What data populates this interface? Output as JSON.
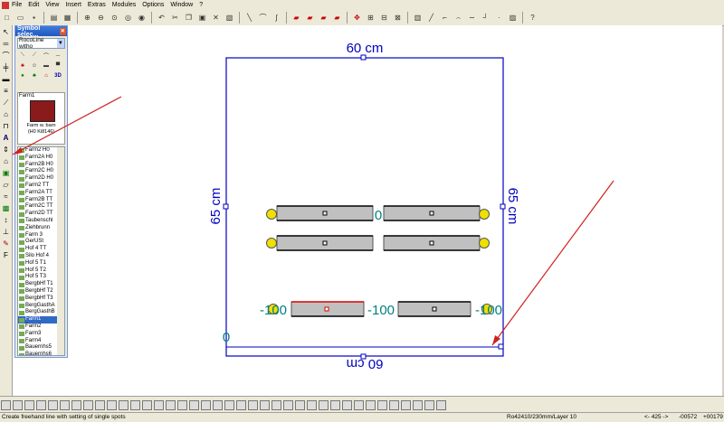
{
  "menu": [
    "File",
    "Edit",
    "View",
    "Insert",
    "Extras",
    "Modules",
    "Options",
    "Window",
    "?"
  ],
  "symbol_panel": {
    "title": "Symbol selec...",
    "library": "RocoLine witho",
    "category_label_3d": "3D",
    "preview_label": "Farm1",
    "preview_caption": "Farm w. barn",
    "preview_caption2": "(H0 Ki8146)",
    "items": [
      "Farm2 H0",
      "Farm2A H0",
      "Farm2B H0",
      "Farm2C H0",
      "Farm2D H0",
      "Farm2 TT",
      "Farm2A TT",
      "Farm2B TT",
      "Farm2C TT",
      "Farm2D TT",
      "Taubenschl",
      "Ziehbrunn",
      "Farm 3",
      "GerUSt",
      "Hof 4 TT",
      "Silo Hof 4",
      "Hof 5 T1",
      "Hof 5 T2",
      "Hof 5 T3",
      "BergbHf T1",
      "BergbHf T2",
      "BergbHf T3",
      "BergGasthA",
      "BergGasthB",
      "Farm1",
      "Farm2",
      "Farm3",
      "Farm4",
      "Bauernhs5",
      "Bauernhs6",
      "Bauernhs7",
      "Bauernhs8",
      "Bauernhs9"
    ],
    "selected_index": 24
  },
  "plan": {
    "top_label": "60 cm",
    "bottom_label": "60 cm",
    "left_label": "65 cm",
    "right_label": "65 cm",
    "label_zero_1": "0",
    "label_zero_2": "0",
    "label_m100_a": "-100",
    "label_m100_b": "-100",
    "label_m100_c": "-100"
  },
  "status": {
    "hint": "Create freehand line with setting of single spots",
    "layer": "Ro42410/230mm/Layer 10",
    "coords_a": "<- 425 ->",
    "coords_b": "-00572",
    "coords_c": "+00179"
  },
  "colors": {
    "plan": "#0000c0",
    "teal": "#008080",
    "arrow": "#d02020",
    "track": "#c0c0c0",
    "buffer": "#f0e000"
  }
}
